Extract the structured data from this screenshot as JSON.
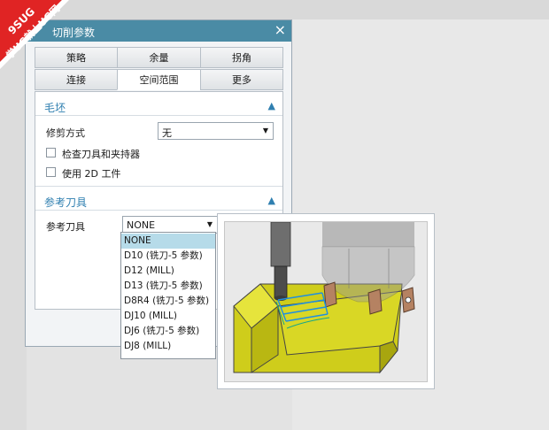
{
  "watermark": {
    "line1": "9SUG",
    "line2": "学UG就上UG网",
    "color": "#e02424"
  },
  "dialog": {
    "title": "切削参数",
    "close_symbol": "×",
    "tabs_row1": [
      "策略",
      "余量",
      "拐角"
    ],
    "tabs_row2": [
      "连接",
      "空间范围",
      "更多"
    ],
    "active_tab": "空间范围"
  },
  "blank_section": {
    "title": "毛坯",
    "trim_label": "修剪方式",
    "trim_value": "无",
    "check_tool_holder": "检查刀具和夹持器",
    "use_2d_workpiece": "使用 2D 工件"
  },
  "ref_tool_section": {
    "title": "参考刀具",
    "label": "参考刀具",
    "selected": "NONE",
    "options": [
      "NONE",
      "D10 (铣刀-5 参数)",
      "D12 (MILL)",
      "D13 (铣刀-5 参数)",
      "D8R4 (铣刀-5 参数)",
      "DJ10 (MILL)",
      "DJ6 (铣刀-5 参数)",
      "DJ8 (MILL)"
    ]
  },
  "colors": {
    "accent": "#2f7fb0",
    "titlebar": "#4a8ba5",
    "selection": "#b6dbe9",
    "part": "#d4d21a"
  }
}
